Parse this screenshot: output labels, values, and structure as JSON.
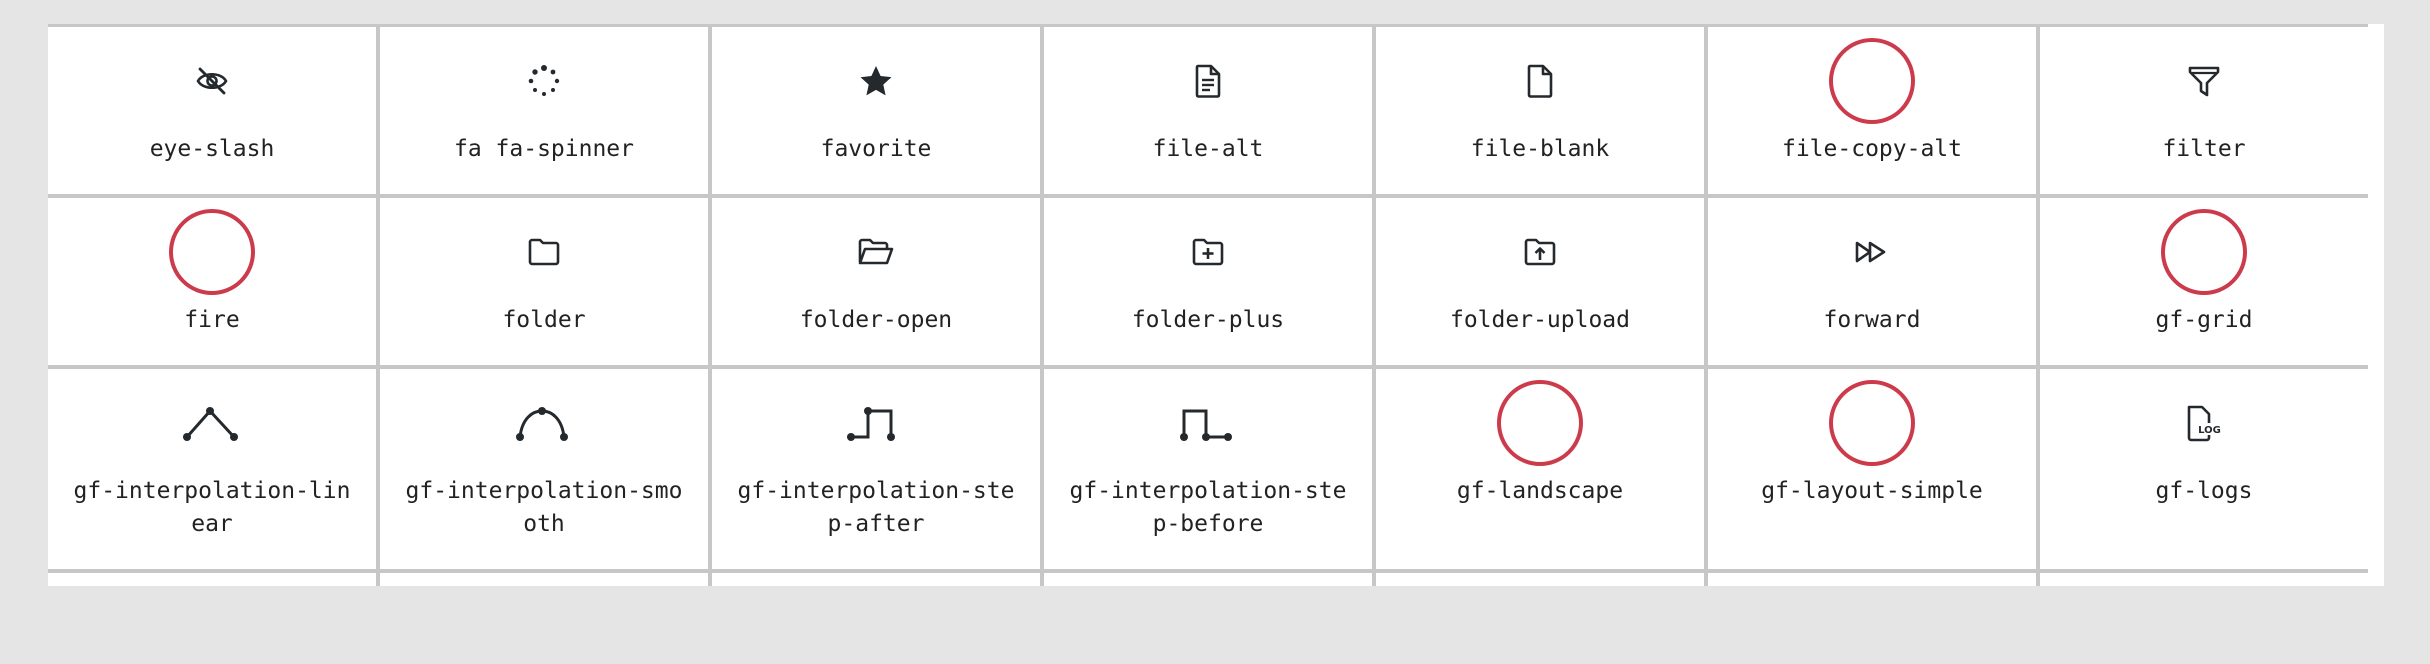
{
  "icons": [
    {
      "name": "eye-slash",
      "icon": "eye-slash-icon"
    },
    {
      "name": "fa fa-spinner",
      "icon": "spinner-icon"
    },
    {
      "name": "favorite",
      "icon": "star-icon"
    },
    {
      "name": "file-alt",
      "icon": "file-alt-icon"
    },
    {
      "name": "file-blank",
      "icon": "file-blank-icon"
    },
    {
      "name": "file-copy-alt",
      "icon": "placeholder-circle-icon"
    },
    {
      "name": "filter",
      "icon": "filter-icon"
    },
    {
      "name": "fire",
      "icon": "placeholder-circle-icon"
    },
    {
      "name": "folder",
      "icon": "folder-icon"
    },
    {
      "name": "folder-open",
      "icon": "folder-open-icon"
    },
    {
      "name": "folder-plus",
      "icon": "folder-plus-icon"
    },
    {
      "name": "folder-upload",
      "icon": "folder-upload-icon"
    },
    {
      "name": "forward",
      "icon": "forward-icon"
    },
    {
      "name": "gf-grid",
      "icon": "placeholder-circle-icon"
    },
    {
      "name": "gf-interpolation-linear",
      "icon": "interpolation-linear-icon"
    },
    {
      "name": "gf-interpolation-smooth",
      "icon": "interpolation-smooth-icon"
    },
    {
      "name": "gf-interpolation-step-after",
      "icon": "interpolation-step-after-icon"
    },
    {
      "name": "gf-interpolation-step-before",
      "icon": "interpolation-step-before-icon"
    },
    {
      "name": "gf-landscape",
      "icon": "placeholder-circle-icon"
    },
    {
      "name": "gf-layout-simple",
      "icon": "placeholder-circle-icon"
    },
    {
      "name": "gf-logs",
      "icon": "logs-icon"
    }
  ],
  "colors": {
    "page_background": "#e5e5e5",
    "cell_background": "#ffffff",
    "grid_lines": "#c7c7c7",
    "placeholder_ring": "#cc3b4b",
    "icon_color": "#24292e"
  }
}
